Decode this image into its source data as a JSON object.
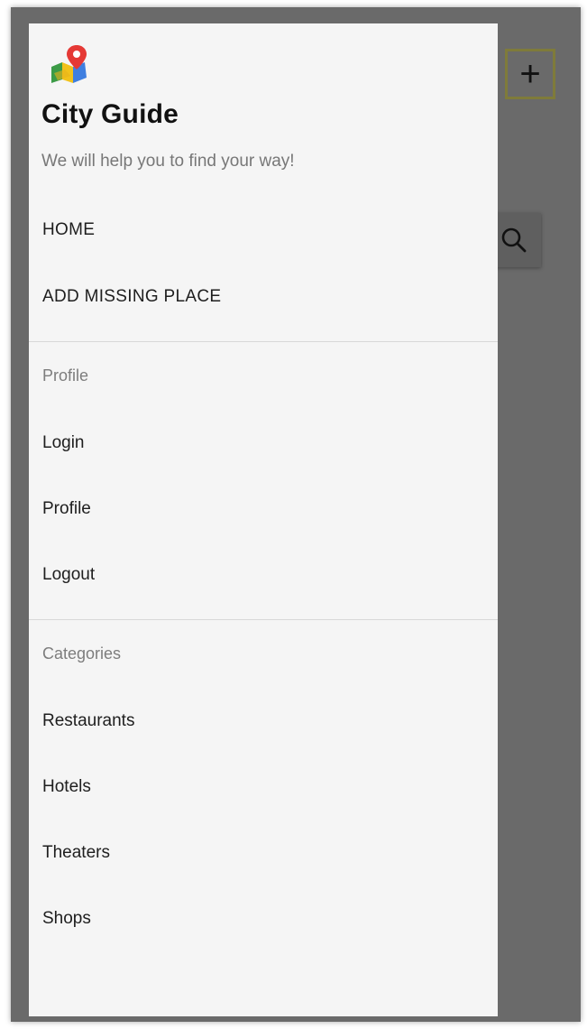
{
  "header": {
    "title": "City Guide",
    "subtitle": "We will help you to find your way!",
    "logo_icon": "map-pin-icon"
  },
  "nav": {
    "main_items": [
      {
        "label": "HOME"
      },
      {
        "label": "ADD MISSING PLACE"
      }
    ],
    "profile_section": {
      "title": "Profile",
      "items": [
        {
          "label": "Login"
        },
        {
          "label": "Profile"
        },
        {
          "label": "Logout"
        }
      ]
    },
    "categories_section": {
      "title": "Categories",
      "items": [
        {
          "label": "Restaurants"
        },
        {
          "label": "Hotels"
        },
        {
          "label": "Theaters"
        },
        {
          "label": "Shops"
        }
      ]
    }
  },
  "background_app": {
    "add_button_icon": "plus-icon",
    "add_button_label": "+",
    "search_button_icon": "search-icon"
  },
  "colors": {
    "drawer_background": "#f5f5f5",
    "scrim": "#6a6a6a",
    "title": "#111111",
    "subtitle": "#777777",
    "section_title": "#7d7d7d",
    "accent_border": "#7f7b3a"
  }
}
